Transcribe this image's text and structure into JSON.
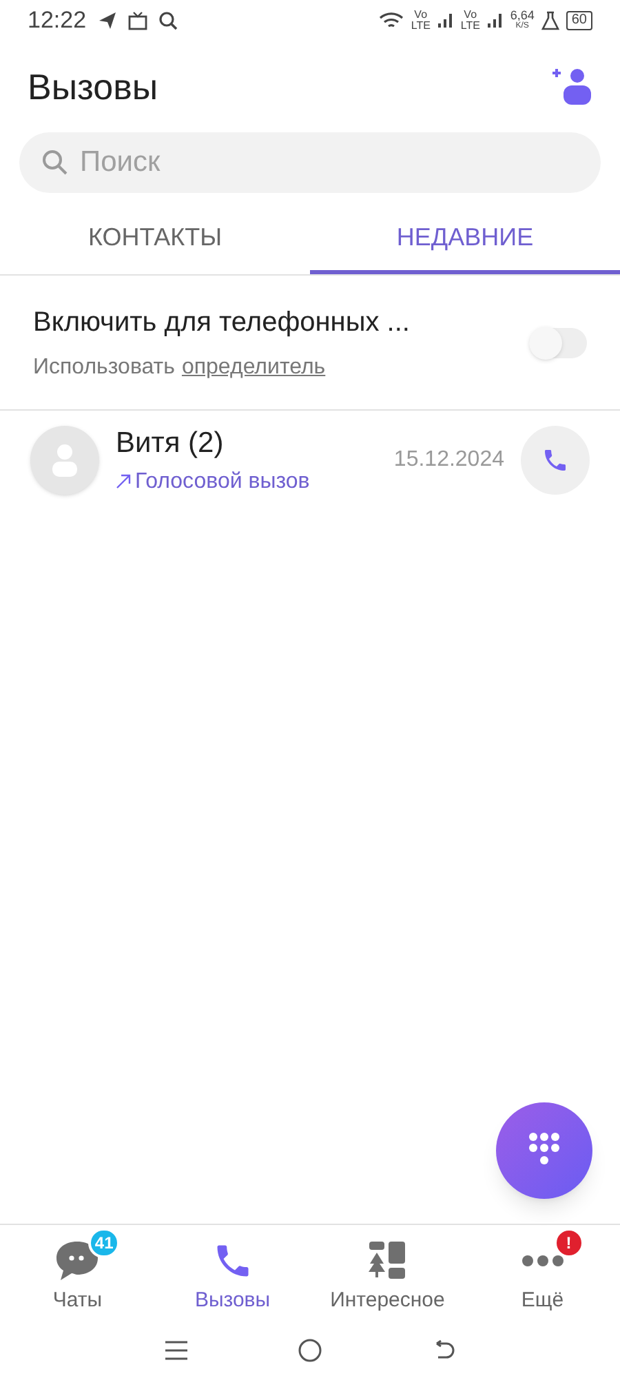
{
  "status_bar": {
    "time": "12:22",
    "network_1": "Vo LTE",
    "network_2": "Vo LTE",
    "speed": "6,64",
    "speed_unit": "K/S",
    "battery": "60"
  },
  "header": {
    "title": "Вызовы"
  },
  "search": {
    "placeholder": "Поиск"
  },
  "tabs": [
    {
      "label": "КОНТАКТЫ",
      "selected": false
    },
    {
      "label": "НЕДАВНИЕ",
      "selected": true
    }
  ],
  "caller_id": {
    "title": "Включить для телефонных ...",
    "subtitle": "Использовать",
    "link": "определитель",
    "on": false
  },
  "calls": [
    {
      "name": "Витя (2)",
      "type": "Голосовой вызов",
      "date": "15.12.2024"
    }
  ],
  "bottom_nav": [
    {
      "kind": "chats",
      "label": "Чаты",
      "badge": {
        "kind": "count",
        "text": "41"
      },
      "selected": false
    },
    {
      "kind": "calls",
      "label": "Вызовы",
      "selected": true
    },
    {
      "kind": "explore",
      "label": "Интересное",
      "selected": false
    },
    {
      "kind": "more",
      "label": "Ещё",
      "badge": {
        "kind": "alert",
        "text": "!"
      },
      "selected": false
    }
  ]
}
